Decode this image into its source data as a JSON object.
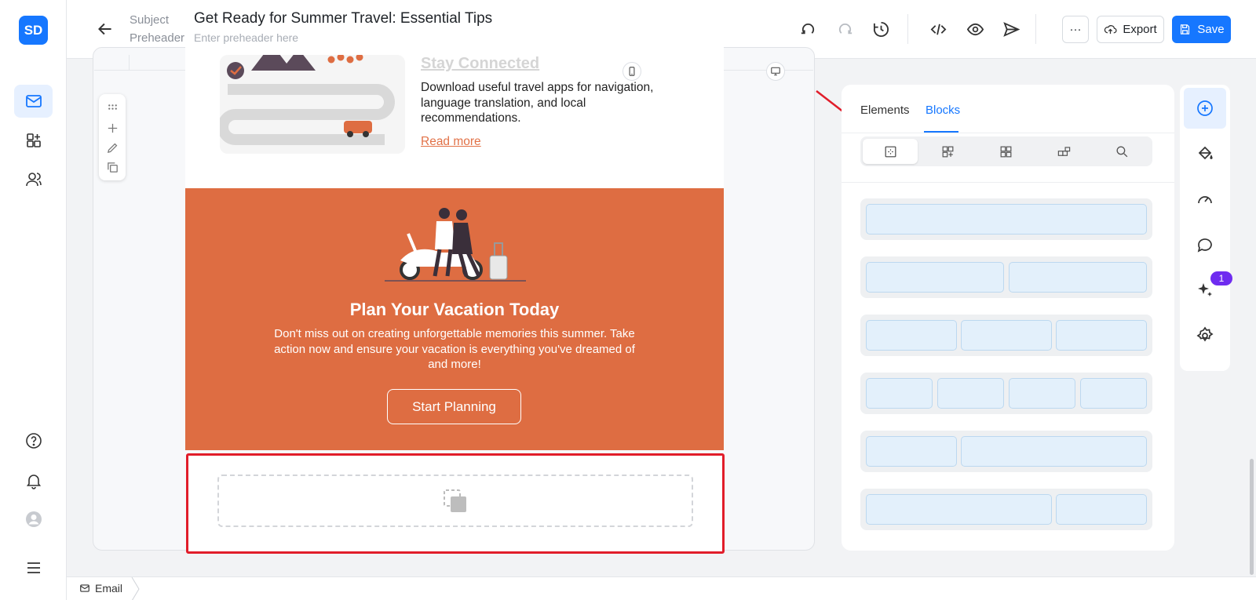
{
  "app": {
    "logo_text": "SD"
  },
  "sidebar": {
    "items": [
      {
        "name": "email",
        "icon": "mail-icon",
        "active": true
      },
      {
        "name": "templates",
        "icon": "blocks-icon",
        "active": false
      },
      {
        "name": "contacts",
        "icon": "users-icon",
        "active": false
      }
    ],
    "bottom": [
      {
        "icon": "help-icon"
      },
      {
        "icon": "bell-icon"
      },
      {
        "icon": "avatar-icon"
      },
      {
        "icon": "menu-icon"
      }
    ]
  },
  "header": {
    "subject_label": "Subject",
    "preheader_label": "Preheader",
    "subject_value": "Get Ready for Summer Travel: Essential Tips",
    "preheader_placeholder": "Enter preheader here",
    "more_label": "···",
    "export_label": "Export",
    "save_label": "Save"
  },
  "email": {
    "section_heading": "Stay Connected",
    "section_text": "Download useful travel apps for navigation, language translation, and local recommendations.",
    "read_more": "Read more",
    "promo_title": "Plan Your Vacation Today",
    "promo_body": "Don't miss out on creating unforgettable memories this summer. Take action now and ensure your vacation is everything you've dreamed of and more!",
    "cta_label": "Start Planning",
    "brand_color": "#de6d42"
  },
  "panel": {
    "tabs": [
      {
        "label": "Elements",
        "active": false
      },
      {
        "label": "Blocks",
        "active": true
      }
    ],
    "block_categories": [
      "layout-icon",
      "add-block-icon",
      "grid-icon",
      "saved-blocks-icon",
      "search-icon"
    ],
    "layouts": [
      {
        "columns": 1
      },
      {
        "columns": 2
      },
      {
        "columns": 3
      },
      {
        "columns": 4
      },
      {
        "columns": 2,
        "ratio": "1:2"
      },
      {
        "columns": 2,
        "ratio": "2:1"
      }
    ]
  },
  "right_strip": {
    "items": [
      "add-icon",
      "paint-bucket-icon",
      "speedometer-icon",
      "chat-icon",
      "sparkles-icon",
      "settings-icon"
    ],
    "ai_badge": "1"
  },
  "status": {
    "breadcrumb": "Email"
  },
  "colors": {
    "accent": "#1677ff",
    "highlight": "#e11d2a",
    "badge": "#6f2cf0"
  }
}
